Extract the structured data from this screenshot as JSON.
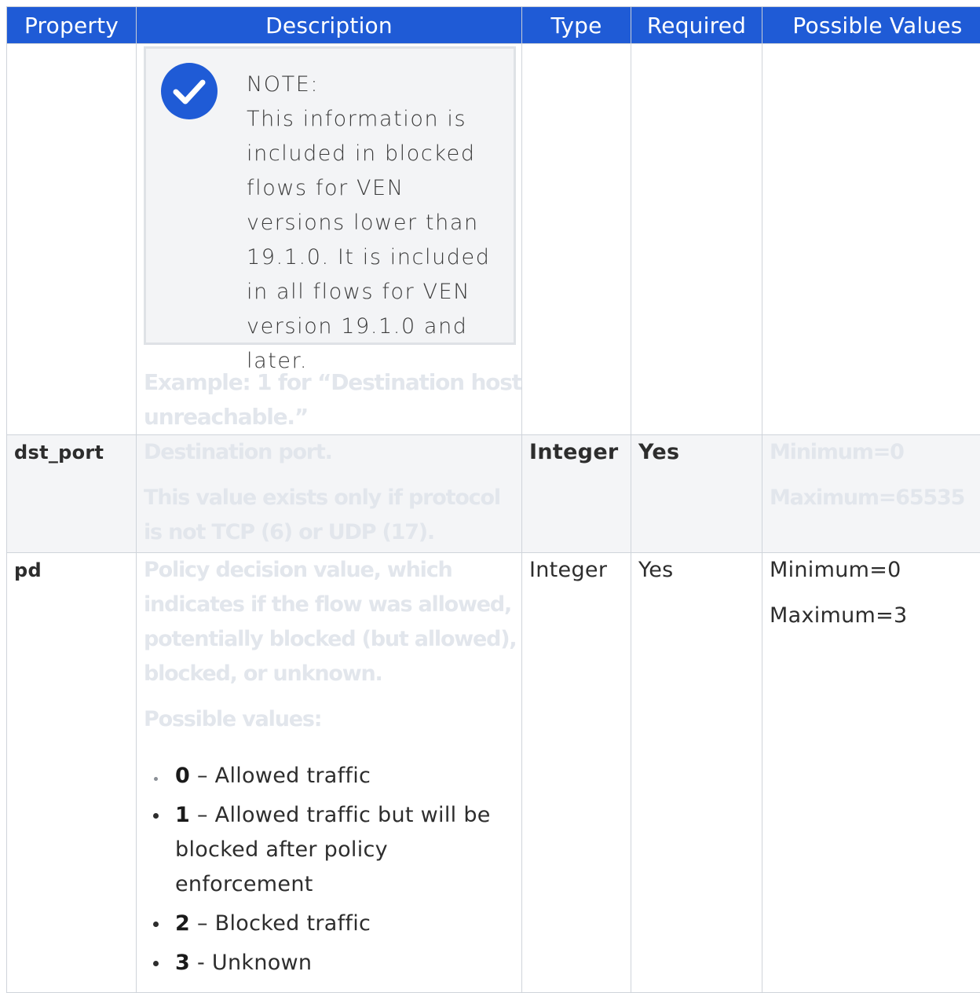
{
  "table": {
    "headers": [
      "Property",
      "Description",
      "Type",
      "Required",
      "Possible Values"
    ]
  },
  "note": {
    "label": "NOTE:",
    "text": "This information is included in blocked flows for VEN versions lower than 19.1.0. It is included in all flows for VEN version 19.1.0 and later.",
    "icon": "check-circle-icon",
    "icon_color": "#1f5bd6"
  },
  "example": "Example: 1 for “Destination host unreachable.”",
  "rows": {
    "dst_port": {
      "property": "dst_port",
      "description_1": "Destination port.",
      "description_2": "This value exists only if protocol is not TCP (6) or UDP (17).",
      "type": "Integer",
      "required": "Yes",
      "min": "Minimum=0",
      "max": "Maximum=65535"
    },
    "pd": {
      "property": "pd",
      "description_1": "Policy decision value, which indicates if the flow was allowed, potentially blocked (but allowed), blocked, or unknown.",
      "description_2": "Possible values:",
      "type": "Integer",
      "required": "Yes",
      "min": "Minimum=0",
      "max": "Maximum=3",
      "values": [
        {
          "code": "0",
          "sep": " – ",
          "text": "Allowed traffic"
        },
        {
          "code": "1",
          "sep": " – ",
          "text": "Allowed traffic but will be blocked after policy enforcement"
        },
        {
          "code": "2",
          "sep": " – ",
          "text": "Blocked traffic"
        },
        {
          "code": "3",
          "sep": " - ",
          "text": "Unknown"
        }
      ]
    }
  },
  "colors": {
    "header_bg": "#1f5bd6",
    "faded_text": "#e2e6ec",
    "shaded_row": "#f4f5f7"
  }
}
